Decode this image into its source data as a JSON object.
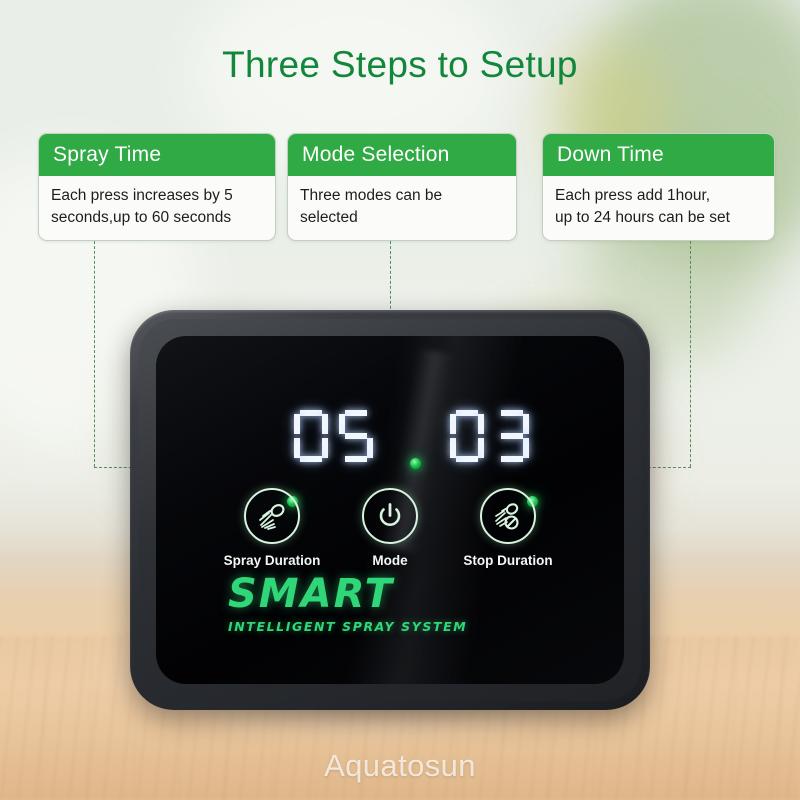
{
  "page": {
    "title": "Three Steps to Setup",
    "watermark": "Aquatosun",
    "accent_green": "#2faa44",
    "title_green": "#12873c",
    "led_green": "#19c44e"
  },
  "cards": [
    {
      "heading": "Spray Time",
      "body": "Each press increases by 5\nseconds,up to 60 seconds"
    },
    {
      "heading": "Mode Selection",
      "body": "Three modes can be\nselected"
    },
    {
      "heading": "Down Time",
      "body": "Each press add 1hour,\nup to 24 hours can be set"
    }
  ],
  "device": {
    "display": {
      "spray_value": "05",
      "stop_value": "03"
    },
    "buttons": [
      {
        "label": "Spray Duration",
        "icon": "spray-nozzle-icon"
      },
      {
        "label": "Mode",
        "icon": "power-icon"
      },
      {
        "label": "Stop Duration",
        "icon": "spray-nozzle-stop-icon"
      }
    ],
    "brand": {
      "name": "SMART",
      "tagline": "INTELLIGENT SPRAY SYSTEM"
    }
  }
}
